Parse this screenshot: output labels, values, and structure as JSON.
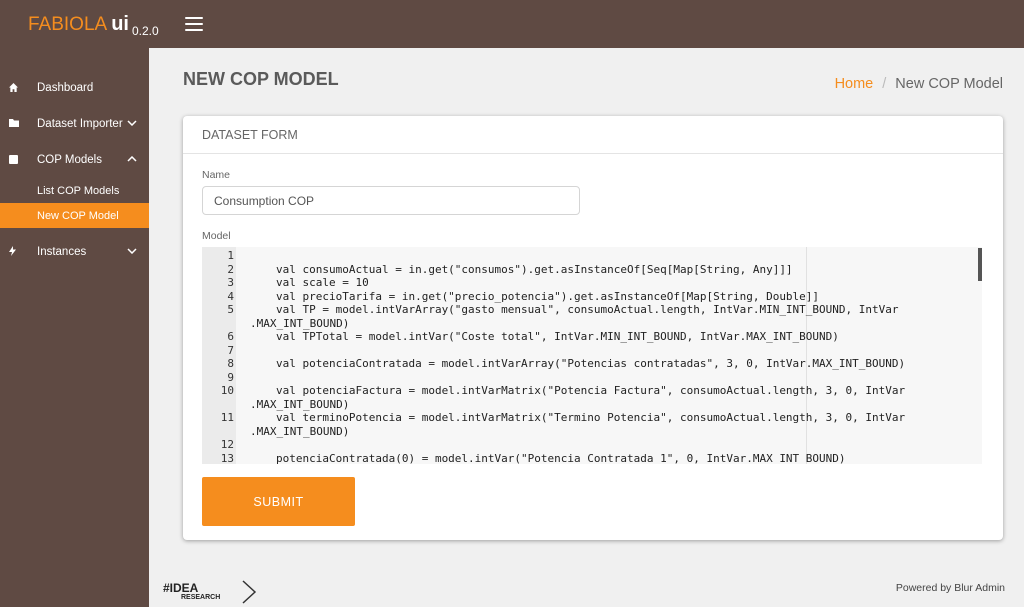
{
  "app": {
    "name": "FABIOLA",
    "ui_label": "ui",
    "version": "0.2.0"
  },
  "sidebar": {
    "items": [
      {
        "label": "Dashboard",
        "icon": "home-icon"
      },
      {
        "label": "Dataset Importer",
        "icon": "folder-icon",
        "expanded": false
      },
      {
        "label": "COP Models",
        "icon": "square-icon",
        "expanded": true,
        "subitems": [
          {
            "label": "List COP Models",
            "active": false
          },
          {
            "label": "New COP Model",
            "active": true
          }
        ]
      },
      {
        "label": "Instances",
        "icon": "bolt-icon",
        "expanded": false
      }
    ]
  },
  "page": {
    "title": "NEW COP MODEL"
  },
  "breadcrumb": {
    "home": "Home",
    "current": "New COP Model"
  },
  "form": {
    "header": "DATASET FORM",
    "name_label": "Name",
    "name_value": "Consumption COP",
    "model_label": "Model",
    "submit_label": "SUBMIT"
  },
  "code": {
    "lines": [
      {
        "n": "1",
        "text": ""
      },
      {
        "n": "2",
        "text": "val consumoActual = in.get(\"consumos\").get.asInstanceOf[Seq[Map[String, Any]]]"
      },
      {
        "n": "3",
        "text": "val scale = 10"
      },
      {
        "n": "4",
        "text": "val precioTarifa = in.get(\"precio_potencia\").get.asInstanceOf[Map[String, Double]]"
      },
      {
        "n": "5",
        "text": "val TP = model.intVarArray(\"gasto mensual\", consumoActual.length, IntVar.MIN_INT_BOUND, IntVar"
      },
      {
        "n": "",
        "text": ".MAX_INT_BOUND)",
        "wrap": true
      },
      {
        "n": "6",
        "text": "val TPTotal = model.intVar(\"Coste total\", IntVar.MIN_INT_BOUND, IntVar.MAX_INT_BOUND)"
      },
      {
        "n": "7",
        "text": ""
      },
      {
        "n": "8",
        "text": "val potenciaContratada = model.intVarArray(\"Potencias contratadas\", 3, 0, IntVar.MAX_INT_BOUND)"
      },
      {
        "n": "9",
        "text": ""
      },
      {
        "n": "10",
        "text": "val potenciaFactura = model.intVarMatrix(\"Potencia Factura\", consumoActual.length, 3, 0, IntVar"
      },
      {
        "n": "",
        "text": ".MAX_INT_BOUND)",
        "wrap": true
      },
      {
        "n": "11",
        "text": "val terminoPotencia = model.intVarMatrix(\"Termino Potencia\", consumoActual.length, 3, 0, IntVar"
      },
      {
        "n": "",
        "text": ".MAX_INT_BOUND)",
        "wrap": true
      },
      {
        "n": "12",
        "text": ""
      },
      {
        "n": "13",
        "text": "potenciaContratada(0) = model.intVar(\"Potencia Contratada 1\", 0, IntVar.MAX_INT_BOUND)"
      }
    ]
  },
  "footer": {
    "logo_main": "#IDEA",
    "logo_sub": "RESEARCH",
    "powered_by": "Powered by Blur Admin"
  },
  "colors": {
    "sidebar": "#5f4a43",
    "accent": "#f58d1e",
    "background": "#f0f0f0"
  }
}
